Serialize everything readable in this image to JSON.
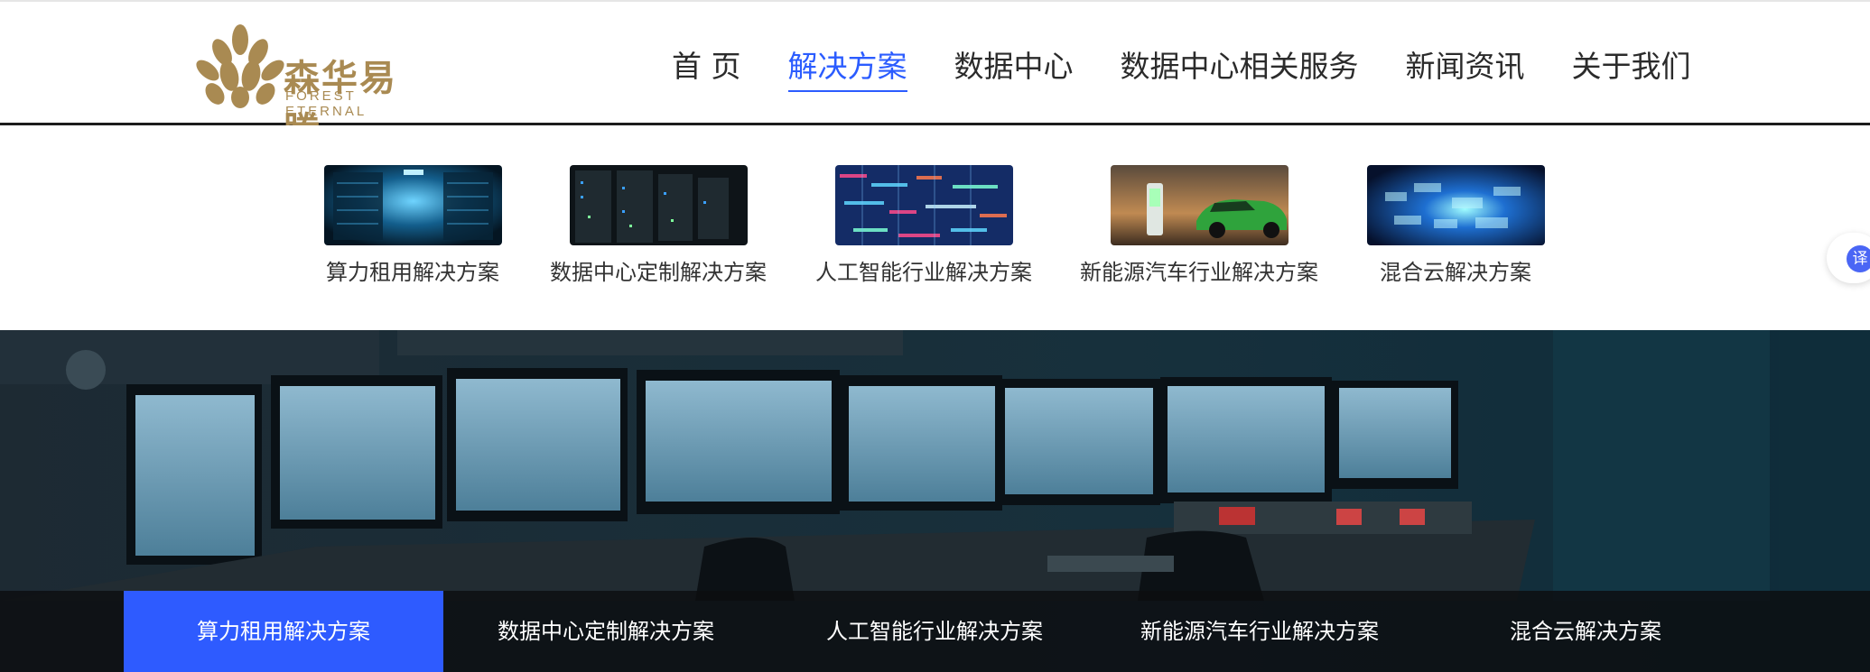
{
  "logo": {
    "name_cn": "森华易腾",
    "name_en": "FOREST ETERNAL"
  },
  "nav": [
    {
      "label": "首 页"
    },
    {
      "label": "解决方案"
    },
    {
      "label": "数据中心"
    },
    {
      "label": "数据中心相关服务"
    },
    {
      "label": "新闻资讯"
    },
    {
      "label": "关于我们"
    }
  ],
  "active_nav": "解决方案",
  "dropdown": [
    {
      "label": "算力租用解决方案"
    },
    {
      "label": "数据中心定制解决方案"
    },
    {
      "label": "人工智能行业解决方案"
    },
    {
      "label": "新能源汽车行业解决方案"
    },
    {
      "label": "混合云解决方案"
    }
  ],
  "translate": {
    "glyph": "译"
  },
  "banner_tabs": [
    {
      "label": "算力租用解决方案"
    },
    {
      "label": "数据中心定制解决方案"
    },
    {
      "label": "人工智能行业解决方案"
    },
    {
      "label": "新能源汽车行业解决方案"
    },
    {
      "label": "混合云解决方案"
    }
  ],
  "colors": {
    "accent": "#2e5bff",
    "brand_gold": "#a98a52"
  }
}
